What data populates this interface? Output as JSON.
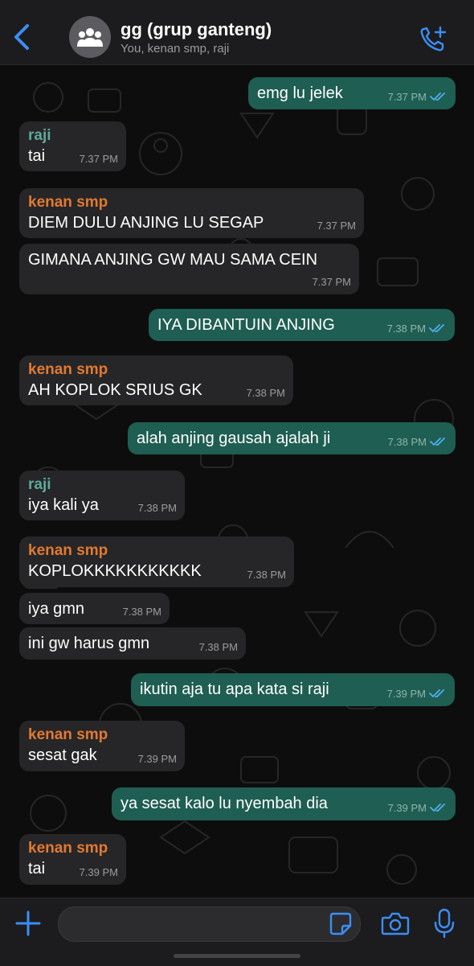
{
  "header": {
    "title": "gg (grup ganteng)",
    "subtitle": "You, kenan smp, raji",
    "back_icon": "chevron-left-icon",
    "call_icon": "phone-add-icon",
    "accent": "#3c8ef6"
  },
  "messages": [
    {
      "dir": "out",
      "text": "emg lu jelek",
      "time": "7.37 PM"
    },
    {
      "dir": "in",
      "sender": "raji",
      "text": "tai",
      "time": "7.37 PM"
    },
    {
      "dir": "in",
      "sender": "kenan smp",
      "text": "DIEM DULU ANJING LU SEGAP",
      "time": "7.37 PM"
    },
    {
      "dir": "in",
      "text": "GIMANA ANJING GW MAU SAMA CEIN",
      "time": "7.37 PM"
    },
    {
      "dir": "out",
      "text": "IYA DIBANTUIN ANJING",
      "time": "7.38 PM"
    },
    {
      "dir": "in",
      "sender": "kenan smp",
      "text": "AH KOPLOK SRIUS GK",
      "time": "7.38 PM"
    },
    {
      "dir": "out",
      "text": "alah anjing gausah ajalah ji",
      "time": "7.38 PM"
    },
    {
      "dir": "in",
      "sender": "raji",
      "text": "iya kali ya",
      "time": "7.38 PM"
    },
    {
      "dir": "in",
      "sender": "kenan smp",
      "text": "KOPLOKKKKKKKKKKK",
      "time": "7.38 PM"
    },
    {
      "dir": "in",
      "text": "iya gmn",
      "time": "7.38 PM"
    },
    {
      "dir": "in",
      "text": "ini gw harus gmn",
      "time": "7.38 PM"
    },
    {
      "dir": "out",
      "text": "ikutin aja tu apa kata si raji",
      "time": "7.39 PM"
    },
    {
      "dir": "in",
      "sender": "kenan smp",
      "text": "sesat gak",
      "time": "7.39 PM"
    },
    {
      "dir": "out",
      "text": "ya sesat kalo lu nyembah dia",
      "time": "7.39 PM"
    },
    {
      "dir": "in",
      "sender": "kenan smp",
      "text": "tai",
      "time": "7.39 PM"
    }
  ],
  "footer": {
    "plus_icon": "plus-icon",
    "sticker_icon": "sticker-icon",
    "camera_icon": "camera-icon",
    "mic_icon": "microphone-icon"
  },
  "colors": {
    "outgoing_bubble": "#1f5e52",
    "incoming_bubble": "#262628",
    "sender_kenan": "#e27a30",
    "sender_raji": "#5fa89a",
    "read_ticks": "#4fb0f0"
  }
}
